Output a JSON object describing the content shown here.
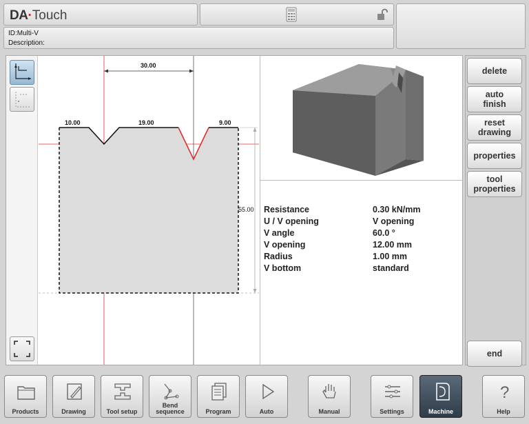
{
  "header": {
    "brand_da": "DA",
    "brand_dot": "·",
    "brand_touch": "Touch"
  },
  "id_bar": {
    "id_label": "ID:Multi-V",
    "description_label": "Description:"
  },
  "drawing": {
    "dim_top": "30.00",
    "dim_left_flat": "10.00",
    "dim_mid_flat": "19.00",
    "dim_right_flat": "9.00",
    "dim_height": "55.00"
  },
  "properties": [
    {
      "key": "Resistance",
      "value": "0.30 kN/mm"
    },
    {
      "key": "U / V opening",
      "value": "V opening"
    },
    {
      "key": "V angle",
      "value": "60.0 °"
    },
    {
      "key": "V opening",
      "value": "12.00 mm"
    },
    {
      "key": "Radius",
      "value": "1.00 mm"
    },
    {
      "key": "V bottom",
      "value": "standard"
    }
  ],
  "side_buttons": {
    "delete": "delete",
    "auto_finish": "auto\nfinish",
    "reset_drawing": "reset\ndrawing",
    "properties": "properties",
    "tool_properties": "tool\nproperties",
    "end": "end"
  },
  "nav": [
    {
      "label": "Products",
      "icon": "folder-icon"
    },
    {
      "label": "Drawing",
      "icon": "pencil-icon"
    },
    {
      "label": "Tool setup",
      "icon": "tool-setup-icon"
    },
    {
      "label": "Bend\nsequence",
      "icon": "bend-sequence-icon"
    },
    {
      "label": "Program",
      "icon": "program-icon"
    },
    {
      "label": "Auto",
      "icon": "play-icon"
    },
    {
      "label": "Manual",
      "icon": "hand-icon"
    },
    {
      "label": "Settings",
      "icon": "settings-icon"
    },
    {
      "label": "Machine",
      "icon": "machine-icon",
      "active": true
    },
    {
      "label": "Help",
      "icon": "help-icon"
    }
  ]
}
